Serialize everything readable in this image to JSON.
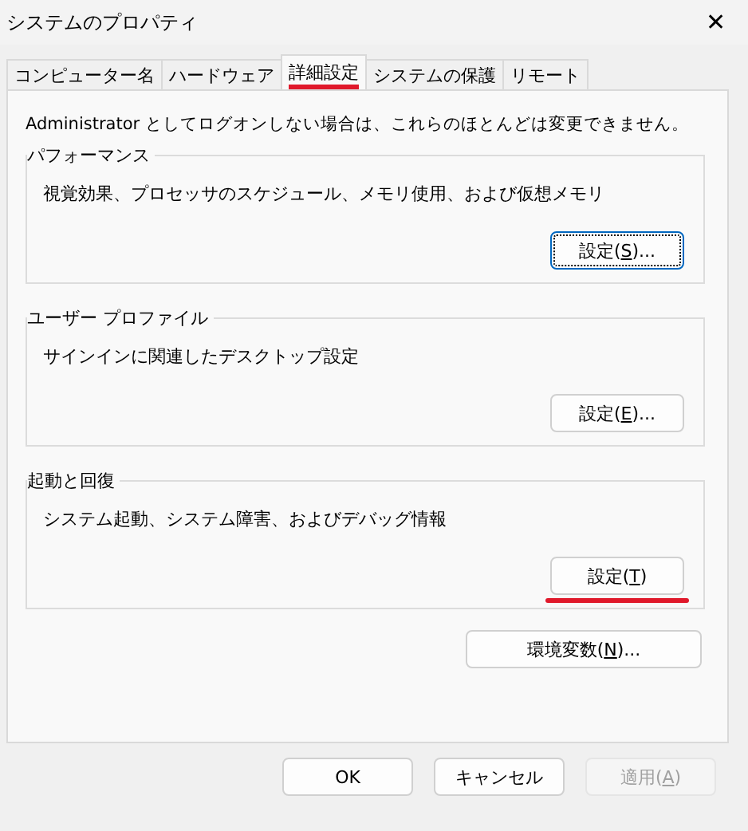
{
  "window": {
    "title": "システムのプロパティ",
    "close": "✕"
  },
  "tabs": [
    {
      "label": "コンピューター名",
      "selected": false,
      "annotated": false
    },
    {
      "label": "ハードウェア",
      "selected": false,
      "annotated": false
    },
    {
      "label": "詳細設定",
      "selected": true,
      "annotated": true
    },
    {
      "label": "システムの保護",
      "selected": false,
      "annotated": false
    },
    {
      "label": "リモート",
      "selected": false,
      "annotated": false
    }
  ],
  "notice": "Administrator としてログオンしない場合は、これらのほとんどは変更できません。",
  "groups": [
    {
      "title": "パフォーマンス",
      "description": "視覚効果、プロセッサのスケジュール、メモリ使用、および仮想メモリ",
      "button": {
        "before": "設定(",
        "mnemonic": "S",
        "after": ")...",
        "focused": true,
        "annotated": false
      }
    },
    {
      "title": "ユーザー プロファイル",
      "description": "サインインに関連したデスクトップ設定",
      "button": {
        "before": "設定(",
        "mnemonic": "E",
        "after": ")...",
        "focused": false,
        "annotated": false
      }
    },
    {
      "title": "起動と回復",
      "description": "システム起動、システム障害、およびデバッグ情報",
      "button": {
        "before": "設定(",
        "mnemonic": "T",
        "after": ")",
        "focused": false,
        "annotated": true
      }
    }
  ],
  "env_button": {
    "before": "環境変数(",
    "mnemonic": "N",
    "after": ")..."
  },
  "buttons": [
    {
      "before": "OK",
      "disabled": false
    },
    {
      "before": "キャンセル",
      "disabled": false
    },
    {
      "before": "適用(",
      "mnemonic": "A",
      "after": ")",
      "disabled": true
    }
  ]
}
